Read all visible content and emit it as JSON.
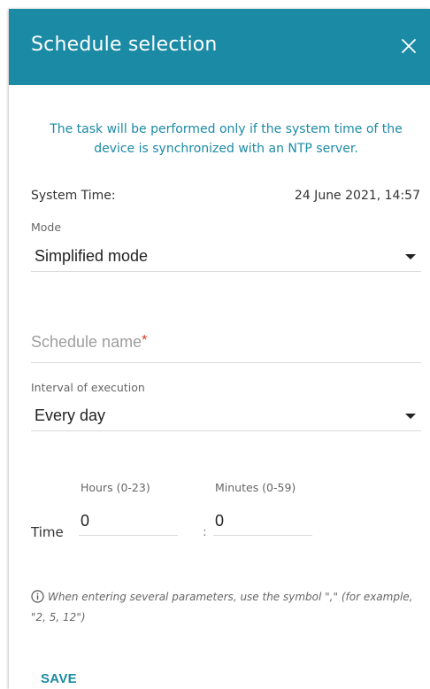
{
  "dialog": {
    "title": "Schedule selection",
    "notice": "The task will be performed only if the system time of the device is synchronized with an NTP server.",
    "system_time": {
      "label": "System Time:",
      "value": "24 June 2021, 14:57"
    },
    "mode": {
      "label": "Mode",
      "value": "Simplified mode"
    },
    "schedule_name": {
      "placeholder": "Schedule name",
      "required_mark": "*",
      "value": ""
    },
    "interval": {
      "label": "Interval of execution",
      "value": "Every day"
    },
    "time": {
      "label": "Time",
      "hours_label": "Hours (0-23)",
      "hours_value": "0",
      "separator": ":",
      "minutes_label": "Minutes (0-59)",
      "minutes_value": "0"
    },
    "hint": "When entering several parameters, use the symbol \",\" (for example, \"2, 5, 12\")",
    "save_label": "SAVE"
  },
  "icons": {
    "close": "close-icon",
    "info": "info-icon",
    "dropdown": "caret-down-icon"
  },
  "colors": {
    "accent": "#1b8aa5",
    "required": "#d0362b"
  }
}
